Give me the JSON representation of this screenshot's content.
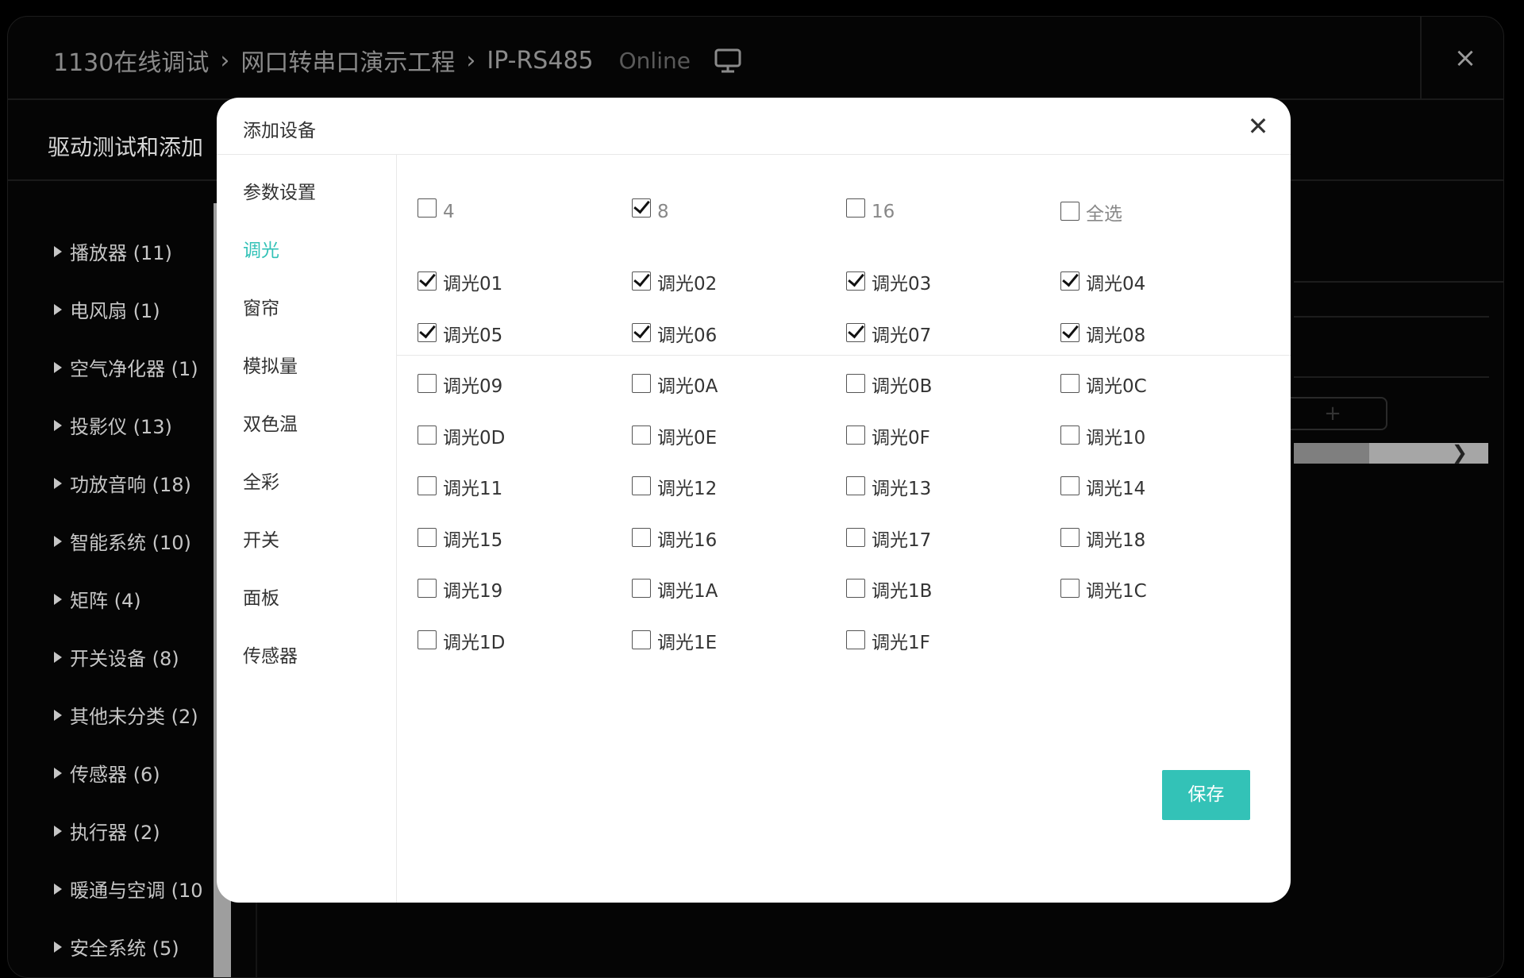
{
  "header": {
    "breadcrumb": [
      "1130在线调试",
      "网口转串口演示工程",
      "IP-RS485"
    ],
    "status": "Online",
    "close_icon": "×"
  },
  "subheader": {
    "title": "驱动测试和添加"
  },
  "sidebar": {
    "categories": [
      "播放器 (11)",
      "电风扇 (1)",
      "空气净化器 (1)",
      "投影仪 (13)",
      "功放音响 (18)",
      "智能系统 (10)",
      "矩阵 (4)",
      "开关设备 (8)",
      "其他未分类 (2)",
      "传感器 (6)",
      "执行器 (2)",
      "暖通与空调 (10",
      "安全系统 (5)"
    ]
  },
  "background": {
    "add_label": "+",
    "scroll_arrow": "❯"
  },
  "modal": {
    "title": "添加设备",
    "close_icon": "✕",
    "nav": [
      "参数设置",
      "调光",
      "窗帘",
      "模拟量",
      "双色温",
      "全彩",
      "开关",
      "面板",
      "传感器"
    ],
    "active_nav": "调光",
    "count_options": [
      {
        "label": "4",
        "checked": false
      },
      {
        "label": "8",
        "checked": true
      },
      {
        "label": "16",
        "checked": false
      },
      {
        "label": "全选",
        "checked": false
      }
    ],
    "channels": [
      {
        "label": "调光01",
        "checked": true
      },
      {
        "label": "调光02",
        "checked": true
      },
      {
        "label": "调光03",
        "checked": true
      },
      {
        "label": "调光04",
        "checked": true
      },
      {
        "label": "调光05",
        "checked": true
      },
      {
        "label": "调光06",
        "checked": true
      },
      {
        "label": "调光07",
        "checked": true
      },
      {
        "label": "调光08",
        "checked": true
      },
      {
        "label": "调光09",
        "checked": false
      },
      {
        "label": "调光0A",
        "checked": false
      },
      {
        "label": "调光0B",
        "checked": false
      },
      {
        "label": "调光0C",
        "checked": false
      },
      {
        "label": "调光0D",
        "checked": false
      },
      {
        "label": "调光0E",
        "checked": false
      },
      {
        "label": "调光0F",
        "checked": false
      },
      {
        "label": "调光10",
        "checked": false
      },
      {
        "label": "调光11",
        "checked": false
      },
      {
        "label": "调光12",
        "checked": false
      },
      {
        "label": "调光13",
        "checked": false
      },
      {
        "label": "调光14",
        "checked": false
      },
      {
        "label": "调光15",
        "checked": false
      },
      {
        "label": "调光16",
        "checked": false
      },
      {
        "label": "调光17",
        "checked": false
      },
      {
        "label": "调光18",
        "checked": false
      },
      {
        "label": "调光19",
        "checked": false
      },
      {
        "label": "调光1A",
        "checked": false
      },
      {
        "label": "调光1B",
        "checked": false
      },
      {
        "label": "调光1C",
        "checked": false
      },
      {
        "label": "调光1D",
        "checked": false
      },
      {
        "label": "调光1E",
        "checked": false
      },
      {
        "label": "调光1F",
        "checked": false
      }
    ],
    "save_label": "保存"
  },
  "colors": {
    "accent": "#33c2b7",
    "app_background": "#050505",
    "modal_background": "#ffffff"
  }
}
